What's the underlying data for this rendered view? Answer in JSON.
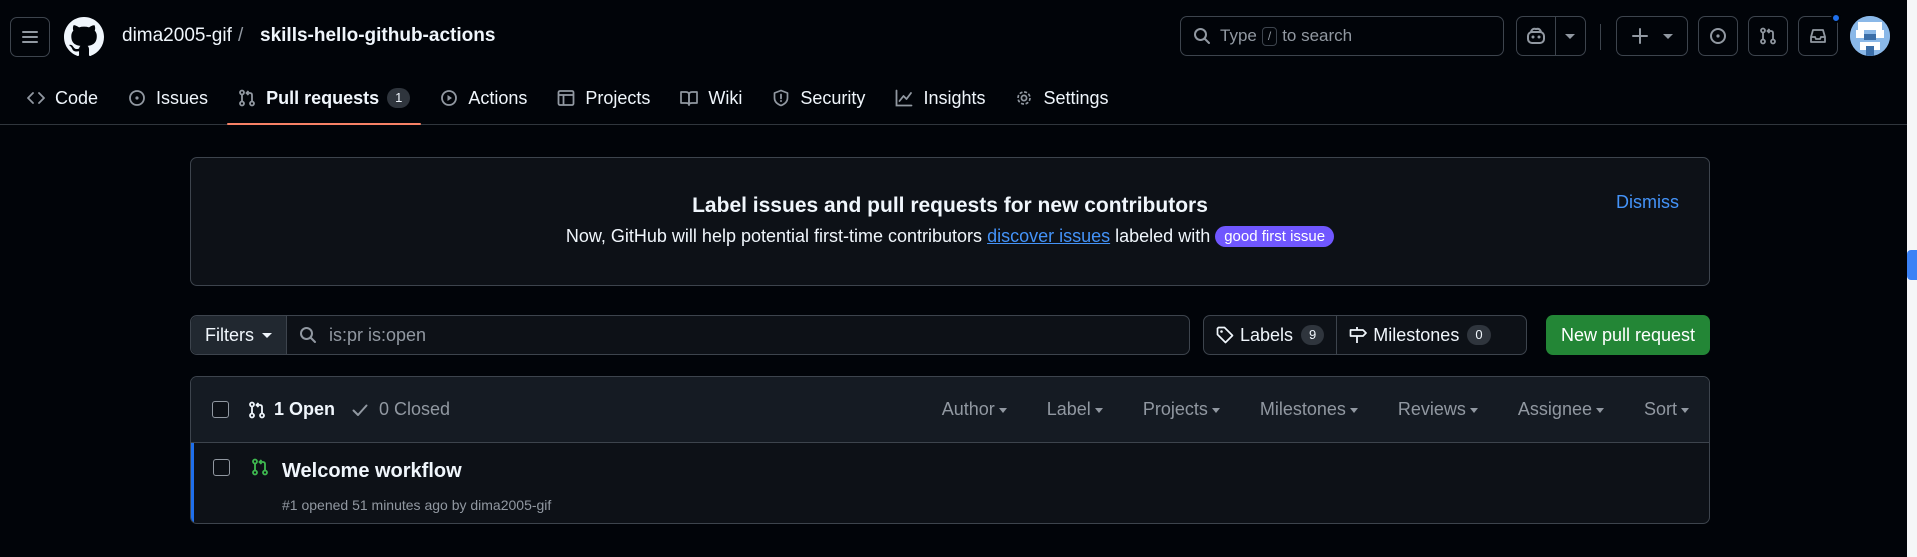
{
  "header": {
    "owner": "dima2005-gif",
    "separator": "/",
    "repo": "skills-hello-github-actions",
    "search": {
      "prefix": "Type",
      "key": "/",
      "suffix": "to search"
    }
  },
  "tabs": [
    {
      "label": "Code",
      "icon": "code-icon"
    },
    {
      "label": "Issues",
      "icon": "issue-opened-icon"
    },
    {
      "label": "Pull requests",
      "icon": "git-pull-request-icon",
      "count": "1",
      "active": true
    },
    {
      "label": "Actions",
      "icon": "play-icon"
    },
    {
      "label": "Projects",
      "icon": "table-icon"
    },
    {
      "label": "Wiki",
      "icon": "book-icon"
    },
    {
      "label": "Security",
      "icon": "shield-icon"
    },
    {
      "label": "Insights",
      "icon": "graph-icon"
    },
    {
      "label": "Settings",
      "icon": "gear-icon"
    }
  ],
  "banner": {
    "title": "Label issues and pull requests for new contributors",
    "text_before": "Now, GitHub will help potential first-time contributors",
    "link": "discover issues",
    "text_after": "labeled with",
    "label": "good first issue",
    "dismiss": "Dismiss"
  },
  "toolbar": {
    "filters_label": "Filters",
    "query": "is:pr is:open",
    "labels_label": "Labels",
    "labels_count": "9",
    "milestones_label": "Milestones",
    "milestones_count": "0",
    "new_pr_label": "New pull request"
  },
  "list": {
    "open_label": "1 Open",
    "closed_label": "0 Closed",
    "filters": [
      "Author",
      "Label",
      "Projects",
      "Milestones",
      "Reviews",
      "Assignee",
      "Sort"
    ],
    "items": [
      {
        "title": "Welcome workflow",
        "meta": "#1 opened 51 minutes ago by dima2005-gif"
      }
    ]
  },
  "colors": {
    "background": "#010409",
    "accent_blue": "#4493f8",
    "green_button": "#238636",
    "label_purple": "#7057ff",
    "active_tab_underline": "#f78166"
  }
}
